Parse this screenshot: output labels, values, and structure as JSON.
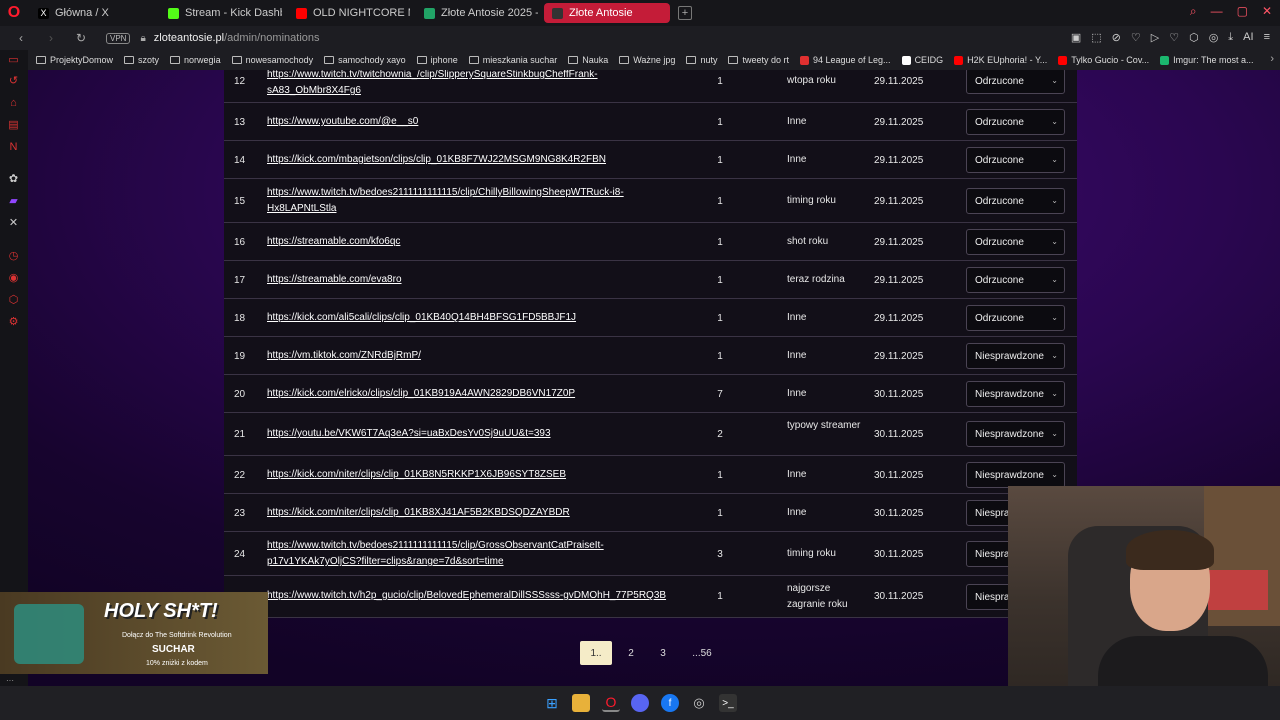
{
  "tabs": [
    {
      "label": "Główna / X",
      "icon": "x-icon",
      "color": "#000000"
    },
    {
      "label": "Stream - Kick Dashboard",
      "icon": "kick-icon",
      "color": "#53fc18"
    },
    {
      "label": "OLD NIGHTCORE MIX *20",
      "icon": "youtube-icon",
      "color": "#ff0000"
    },
    {
      "label": "Złote Antosie 2025 - Arku",
      "icon": "sheets-icon",
      "color": "#21a366"
    },
    {
      "label": "Złote Antosie",
      "icon": "site-icon",
      "color": "#333333"
    }
  ],
  "address": {
    "domain": "zloteantosie.pl",
    "path": "/admin/nominations",
    "vpn": "VPN"
  },
  "bookmarks": [
    {
      "label": "ProjektyDomow",
      "type": "folder"
    },
    {
      "label": "szoty",
      "type": "folder"
    },
    {
      "label": "norwegia",
      "type": "folder"
    },
    {
      "label": "nowesamochody",
      "type": "folder"
    },
    {
      "label": "samochody xayo",
      "type": "folder"
    },
    {
      "label": "iphone",
      "type": "folder"
    },
    {
      "label": "mieszkania suchar",
      "type": "folder"
    },
    {
      "label": "Nauka",
      "type": "folder"
    },
    {
      "label": "Ważne jpg",
      "type": "folder"
    },
    {
      "label": "nuty",
      "type": "folder"
    },
    {
      "label": "tweety do rt",
      "type": "folder"
    },
    {
      "label": "94 League of Leg...",
      "type": "site",
      "color": "#e03030"
    },
    {
      "label": "CEIDG",
      "type": "site",
      "color": "#ffffff"
    },
    {
      "label": "H2K EUphoria! - Y...",
      "type": "site",
      "color": "#ff0000"
    },
    {
      "label": "Tylko Gucio - Cov...",
      "type": "site",
      "color": "#ff0000"
    },
    {
      "label": "Imgur: The most a...",
      "type": "site",
      "color": "#1bb76e"
    }
  ],
  "rows": [
    {
      "num": "12",
      "link": "https://www.twitch.tv/twitchownia_/clip/SlipperySquareStinkbugCheffFrank-sA83_ObMbr8X4Fg6",
      "votes": "1",
      "category": "wtopa roku",
      "date": "29.11.2025",
      "status": "Odrzucone"
    },
    {
      "num": "13",
      "link": "https://www.youtube.com/@e__s0",
      "votes": "1",
      "category": "Inne",
      "date": "29.11.2025",
      "status": "Odrzucone"
    },
    {
      "num": "14",
      "link": "https://kick.com/mbagietson/clips/clip_01KB8F7WJ22MSGM9NG8K4R2FBN",
      "votes": "1",
      "category": "Inne",
      "date": "29.11.2025",
      "status": "Odrzucone"
    },
    {
      "num": "15",
      "link": "https://www.twitch.tv/bedoes2111111111115/clip/ChillyBillowingSheepWTRuck-i8-Hx8LAPNtLStla",
      "votes": "1",
      "category": "timing roku",
      "date": "29.11.2025",
      "status": "Odrzucone"
    },
    {
      "num": "16",
      "link": "https://streamable.com/kfo6qc",
      "votes": "1",
      "category": "shot roku",
      "date": "29.11.2025",
      "status": "Odrzucone"
    },
    {
      "num": "17",
      "link": "https://streamable.com/eva8ro",
      "votes": "1",
      "category": "teraz rodzina",
      "date": "29.11.2025",
      "status": "Odrzucone"
    },
    {
      "num": "18",
      "link": "https://kick.com/ali5cali/clips/clip_01KB40Q14BH4BFSG1FD5BBJF1J",
      "votes": "1",
      "category": "Inne",
      "date": "29.11.2025",
      "status": "Odrzucone"
    },
    {
      "num": "19",
      "link": "https://vm.tiktok.com/ZNRdBjRmP/",
      "votes": "1",
      "category": "Inne",
      "date": "29.11.2025",
      "status": "Niesprawdzone"
    },
    {
      "num": "20",
      "link": "https://kick.com/elricko/clips/clip_01KB919A4AWN2829DB6VN17Z0P",
      "votes": "7",
      "category": "Inne",
      "date": "30.11.2025",
      "status": "Niesprawdzone"
    },
    {
      "num": "21",
      "link": "https://youtu.be/VKW6T7Aq3eA?si=uaBxDesYv0Sj9uUU&t=393",
      "votes": "2",
      "category": "typowy streamer",
      "date": "30.11.2025",
      "status": "Niesprawdzone"
    },
    {
      "num": "22",
      "link": "https://kick.com/niter/clips/clip_01KB8N5RKKP1X6JB96SYT8ZSEB",
      "votes": "1",
      "category": "Inne",
      "date": "30.11.2025",
      "status": "Niesprawdzone"
    },
    {
      "num": "23",
      "link": "https://kick.com/niter/clips/clip_01KB8XJ41AF5B2KBDSQDZAYBDR",
      "votes": "1",
      "category": "Inne",
      "date": "30.11.2025",
      "status": "Niespra"
    },
    {
      "num": "24",
      "link": "https://www.twitch.tv/bedoes2111111111115/clip/GrossObservantCatPraiseIt-p17v1YKAk7yOljCS?filter=clips&range=7d&sort=time",
      "votes": "3",
      "category": "timing roku",
      "date": "30.11.2025",
      "status": "Niespra"
    },
    {
      "num": "25",
      "link": "https://www.twitch.tv/h2p_gucio/clip/BelovedEphemeralDillSSSsss-gvDMOhH_77P5RQ3B",
      "votes": "1",
      "category": "najgorsze zagranie roku",
      "date": "30.11.2025",
      "status": "Niespra"
    }
  ],
  "pagination": [
    "1..",
    "2",
    "3",
    "...56"
  ],
  "promo": {
    "title": "HOLY SH*T!",
    "subtitle": "Dołącz do The Softdrink Revolution",
    "brand": "SUCHAR",
    "note": "10% zniżki z kodem"
  },
  "colors": {
    "accent": "#c41c38",
    "page_bg": "#2a0650",
    "table_bg": "#120f18",
    "pager_active": "#f5ecc8"
  }
}
